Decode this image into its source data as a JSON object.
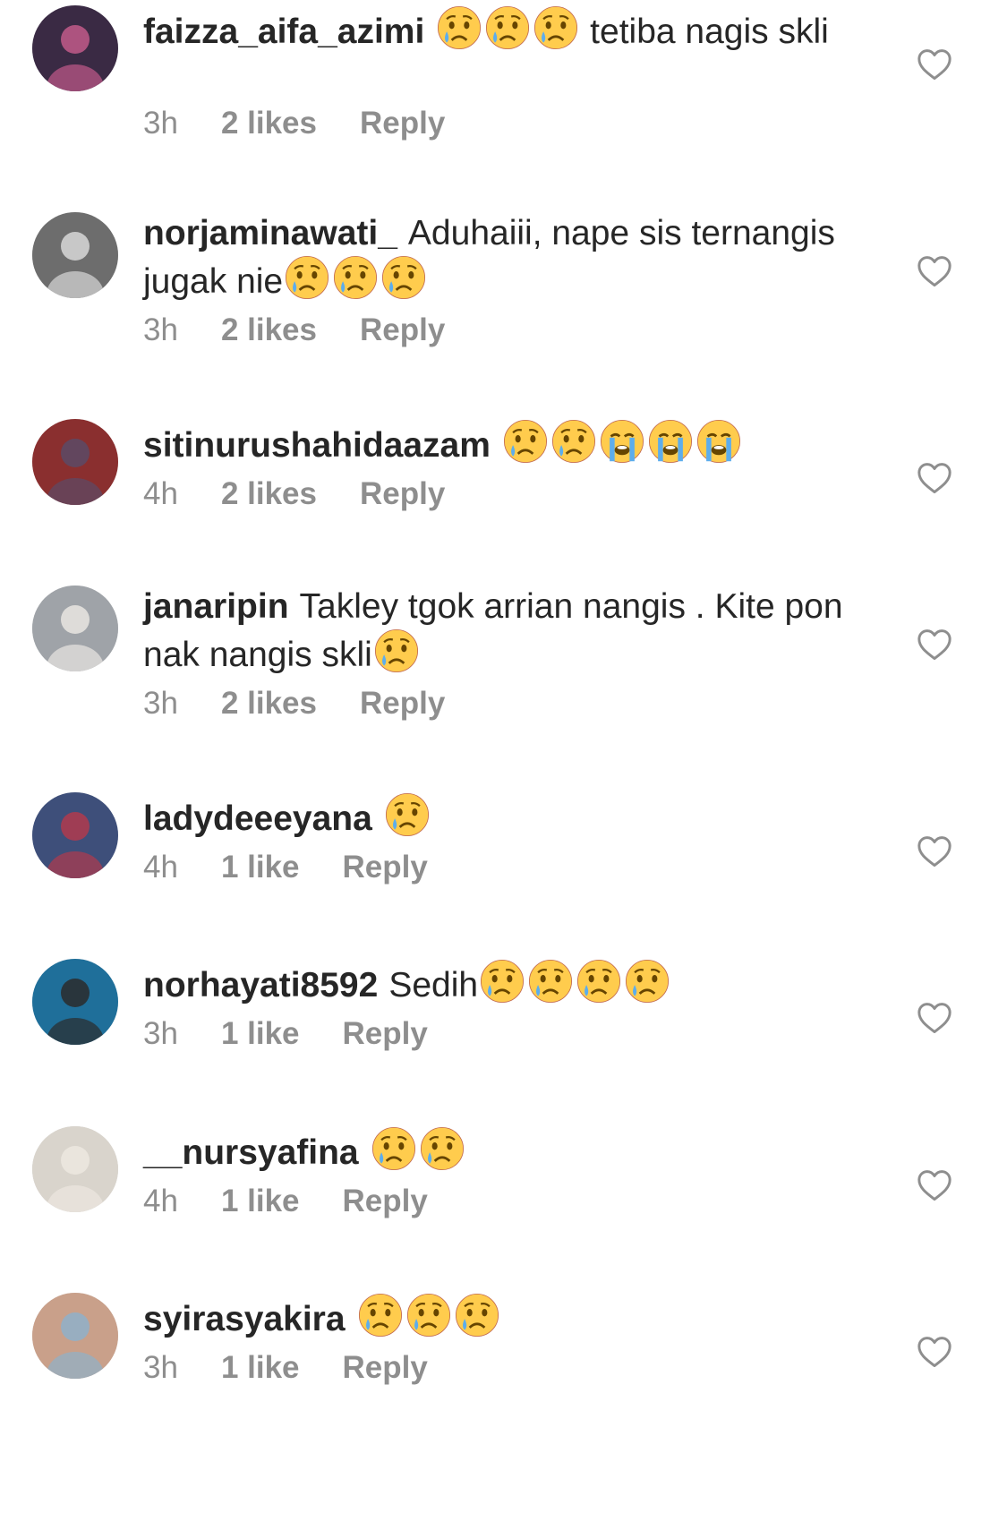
{
  "comments": [
    {
      "username": "faizza_aifa_azimi",
      "emojis_before": [
        "crying-face-icon",
        "crying-face-icon",
        "crying-face-icon"
      ],
      "text": "tetiba nagis skli",
      "emojis_after": [],
      "time": "3h",
      "likes": "2 likes",
      "reply": "Reply",
      "avatar_colors": [
        "#3a2a44",
        "#c25a8a"
      ]
    },
    {
      "username": "norjaminawati_",
      "emojis_before": [],
      "text": "Aduhaiii, nape sis ternangis jugak nie",
      "emojis_after": [
        "crying-face-icon",
        "crying-face-icon",
        "crying-face-icon"
      ],
      "time": "3h",
      "likes": "2 likes",
      "reply": "Reply",
      "avatar_colors": [
        "#6d6d6d",
        "#d8d8d8"
      ]
    },
    {
      "username": "sitinurushahidaazam",
      "emojis_before": [],
      "text": "",
      "emojis_after": [
        "crying-face-icon",
        "crying-face-icon",
        "loudly-crying-face-icon",
        "loudly-crying-face-icon",
        "loudly-crying-face-icon"
      ],
      "time": "4h",
      "likes": "2 likes",
      "reply": "Reply",
      "avatar_colors": [
        "#8a2f2f",
        "#5b4a66"
      ]
    },
    {
      "username": "janaripin",
      "emojis_before": [],
      "text": "Takley tgok arrian nangis . Kite pon nak nangis skli",
      "emojis_after": [
        "crying-face-icon"
      ],
      "time": "3h",
      "likes": "2 likes",
      "reply": "Reply",
      "avatar_colors": [
        "#9fa3a8",
        "#e9e6e2"
      ]
    },
    {
      "username": "ladydeeeyana",
      "emojis_before": [],
      "text": "",
      "emojis_after": [
        "crying-face-icon"
      ],
      "time": "4h",
      "likes": "1 like",
      "reply": "Reply",
      "avatar_colors": [
        "#3e4f7a",
        "#b03a4d"
      ]
    },
    {
      "username": "norhayati8592",
      "emojis_before": [],
      "text": "Sedih",
      "emojis_after": [
        "crying-face-icon",
        "crying-face-icon",
        "crying-face-icon",
        "crying-face-icon"
      ],
      "time": "3h",
      "likes": "1 like",
      "reply": "Reply",
      "avatar_colors": [
        "#1f6f9a",
        "#2b2b2b"
      ]
    },
    {
      "username": "__nursyafina",
      "emojis_before": [],
      "text": "",
      "emojis_after": [
        "crying-face-icon",
        "crying-face-icon"
      ],
      "time": "4h",
      "likes": "1 like",
      "reply": "Reply",
      "avatar_colors": [
        "#d9d4cc",
        "#ece7df"
      ]
    },
    {
      "username": "syirasyakira",
      "emojis_before": [],
      "text": "",
      "emojis_after": [
        "crying-face-icon",
        "crying-face-icon",
        "crying-face-icon"
      ],
      "time": "3h",
      "likes": "1 like",
      "reply": "Reply",
      "avatar_colors": [
        "#c9a08a",
        "#8fb0c9"
      ]
    }
  ],
  "colors": {
    "text": "#262626",
    "meta": "#8e8e8e",
    "heart_outline": "#8e8e8e",
    "emoji_face": "#FFCC4D",
    "emoji_tear": "#5DADEC"
  }
}
